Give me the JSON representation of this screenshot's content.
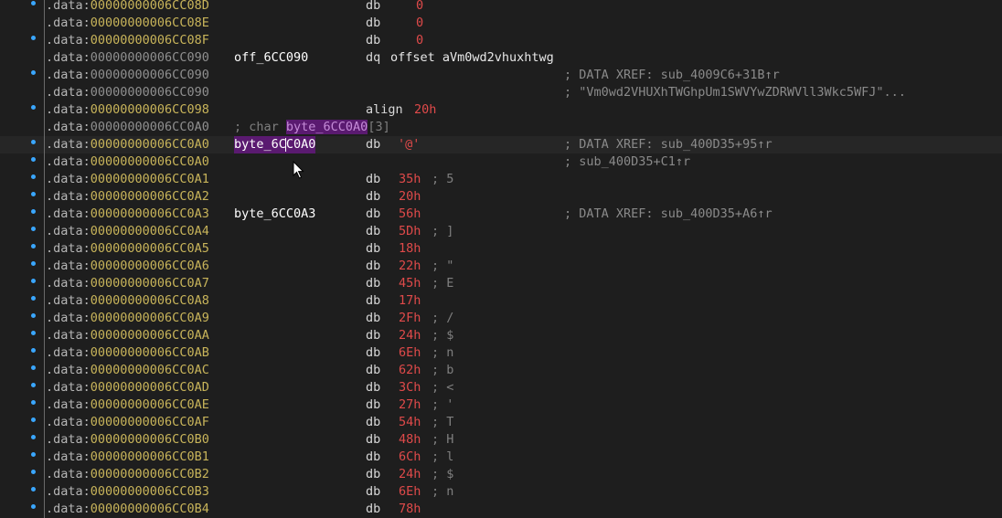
{
  "listing": {
    "segment": ".data:",
    "rows": [
      {
        "addr": "00000000006CC08D",
        "mnem": "db",
        "opnd": "0",
        "type": "num"
      },
      {
        "addr": "00000000006CC08E",
        "mnem": "db",
        "opnd": "0",
        "type": "num"
      },
      {
        "addr": "00000000006CC08F",
        "mnem": "db",
        "opnd": "0",
        "type": "num"
      },
      {
        "addr": "00000000006CC090",
        "label": "off_6CC090",
        "mnem": "dq",
        "opnd": "offset aVm0wd2vhuxhtwg",
        "type": "ref"
      },
      {
        "addr": "00000000006CC090",
        "xref": "; DATA XREF: sub_4009C6+31B↑r"
      },
      {
        "addr": "00000000006CC090",
        "xref": "; \"Vm0wd2VHUXhTWGhpUm1SWVYwZDRWVll3Wkc5WFJ\"..."
      },
      {
        "addr": "00000000006CC098",
        "mnem": "align",
        "opnd": "20h",
        "type": "num"
      },
      {
        "addr": "00000000006CC0A0",
        "comment_prefix": "; char ",
        "comment_name": "byte_6CC0A0",
        "comment_suffix": "[3]"
      },
      {
        "addr": "00000000006CC0A0",
        "label": "byte_6CC0A0",
        "mnem": "db",
        "opnd": "'@'",
        "type": "str",
        "xref": "; DATA XREF: sub_400D35+95↑r"
      },
      {
        "addr": "00000000006CC0A0",
        "xref": "; sub_400D35+C1↑r"
      },
      {
        "addr": "00000000006CC0A1",
        "mnem": "db",
        "opnd": "35h",
        "type": "num",
        "cmt": "; 5"
      },
      {
        "addr": "00000000006CC0A2",
        "mnem": "db",
        "opnd": "20h",
        "type": "num"
      },
      {
        "addr": "00000000006CC0A3",
        "label": "byte_6CC0A3",
        "mnem": "db",
        "opnd": "56h",
        "type": "num",
        "xref": "; DATA XREF: sub_400D35+A6↑r"
      },
      {
        "addr": "00000000006CC0A4",
        "mnem": "db",
        "opnd": "5Dh",
        "type": "num",
        "cmt": "; ]"
      },
      {
        "addr": "00000000006CC0A5",
        "mnem": "db",
        "opnd": "18h",
        "type": "num"
      },
      {
        "addr": "00000000006CC0A6",
        "mnem": "db",
        "opnd": "22h",
        "type": "num",
        "cmt": "; \""
      },
      {
        "addr": "00000000006CC0A7",
        "mnem": "db",
        "opnd": "45h",
        "type": "num",
        "cmt": "; E"
      },
      {
        "addr": "00000000006CC0A8",
        "mnem": "db",
        "opnd": "17h",
        "type": "num"
      },
      {
        "addr": "00000000006CC0A9",
        "mnem": "db",
        "opnd": "2Fh",
        "type": "num",
        "cmt": "; /"
      },
      {
        "addr": "00000000006CC0AA",
        "mnem": "db",
        "opnd": "24h",
        "type": "num",
        "cmt": "; $"
      },
      {
        "addr": "00000000006CC0AB",
        "mnem": "db",
        "opnd": "6Eh",
        "type": "num",
        "cmt": "; n"
      },
      {
        "addr": "00000000006CC0AC",
        "mnem": "db",
        "opnd": "62h",
        "type": "num",
        "cmt": "; b"
      },
      {
        "addr": "00000000006CC0AD",
        "mnem": "db",
        "opnd": "3Ch",
        "type": "num",
        "cmt": "; <"
      },
      {
        "addr": "00000000006CC0AE",
        "mnem": "db",
        "opnd": "27h",
        "type": "num",
        "cmt": "; '"
      },
      {
        "addr": "00000000006CC0AF",
        "mnem": "db",
        "opnd": "54h",
        "type": "num",
        "cmt": "; T"
      },
      {
        "addr": "00000000006CC0B0",
        "mnem": "db",
        "opnd": "48h",
        "type": "num",
        "cmt": "; H"
      },
      {
        "addr": "00000000006CC0B1",
        "mnem": "db",
        "opnd": "6Ch",
        "type": "num",
        "cmt": "; l"
      },
      {
        "addr": "00000000006CC0B2",
        "mnem": "db",
        "opnd": "24h",
        "type": "num",
        "cmt": "; $"
      },
      {
        "addr": "00000000006CC0B3",
        "mnem": "db",
        "opnd": "6Eh",
        "type": "num",
        "cmt": "; n"
      },
      {
        "addr": "00000000006CC0B4",
        "mnem": "db",
        "opnd": "78h",
        "type": "num"
      }
    ]
  },
  "colors": {
    "background": "#1e1e1e",
    "address": "#c8b45a",
    "number": "#e04a4a",
    "comment": "#7f7f7f",
    "highlight": "#5a1a70",
    "breakpoint_dot": "#3aa7ff"
  }
}
